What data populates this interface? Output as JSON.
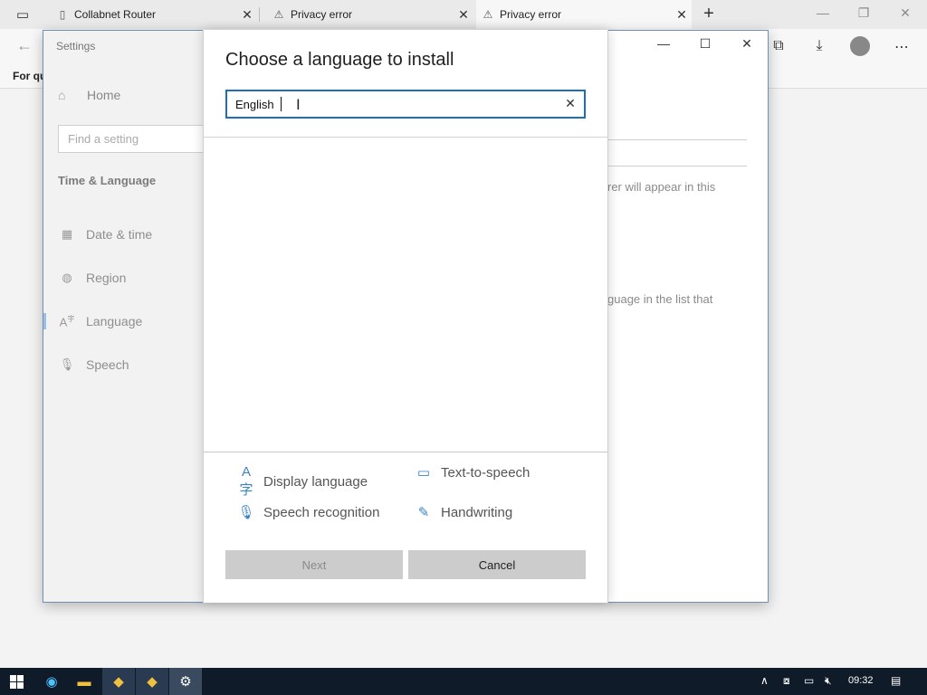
{
  "browser": {
    "tabs": [
      {
        "label": "Collabnet Router",
        "icon": "page-icon"
      },
      {
        "label": "Privacy error",
        "icon": "warning-lock-icon"
      },
      {
        "label": "Privacy error",
        "icon": "warning-lock-icon"
      }
    ],
    "new_tab_label": "+",
    "favorites_text": "For qu"
  },
  "settings": {
    "title": "Settings",
    "home_label": "Home",
    "search_placeholder": "Find a setting",
    "section_label": "Time & Language",
    "nav_items": [
      {
        "label": "Date & time",
        "icon": "calendar-icon"
      },
      {
        "label": "Region",
        "icon": "globe-icon"
      },
      {
        "label": "Language",
        "icon": "language-icon",
        "selected": true
      },
      {
        "label": "Speech",
        "icon": "microphone-icon"
      }
    ],
    "bg_text_1": "rer will appear in this",
    "bg_text_2": "guage in the list that"
  },
  "dialog": {
    "title": "Choose a language to install",
    "search_value": "English",
    "features": [
      {
        "label": "Display language",
        "icon": "display-language-icon"
      },
      {
        "label": "Text-to-speech",
        "icon": "text-to-speech-icon"
      },
      {
        "label": "Speech recognition",
        "icon": "microphone-icon"
      },
      {
        "label": "Handwriting",
        "icon": "handwriting-icon"
      }
    ],
    "next_label": "Next",
    "cancel_label": "Cancel"
  },
  "taskbar": {
    "time": "09:32"
  },
  "colors": {
    "accent": "#1f6fb8",
    "taskbar": "#101b2a",
    "button_bg": "#cccccc"
  }
}
